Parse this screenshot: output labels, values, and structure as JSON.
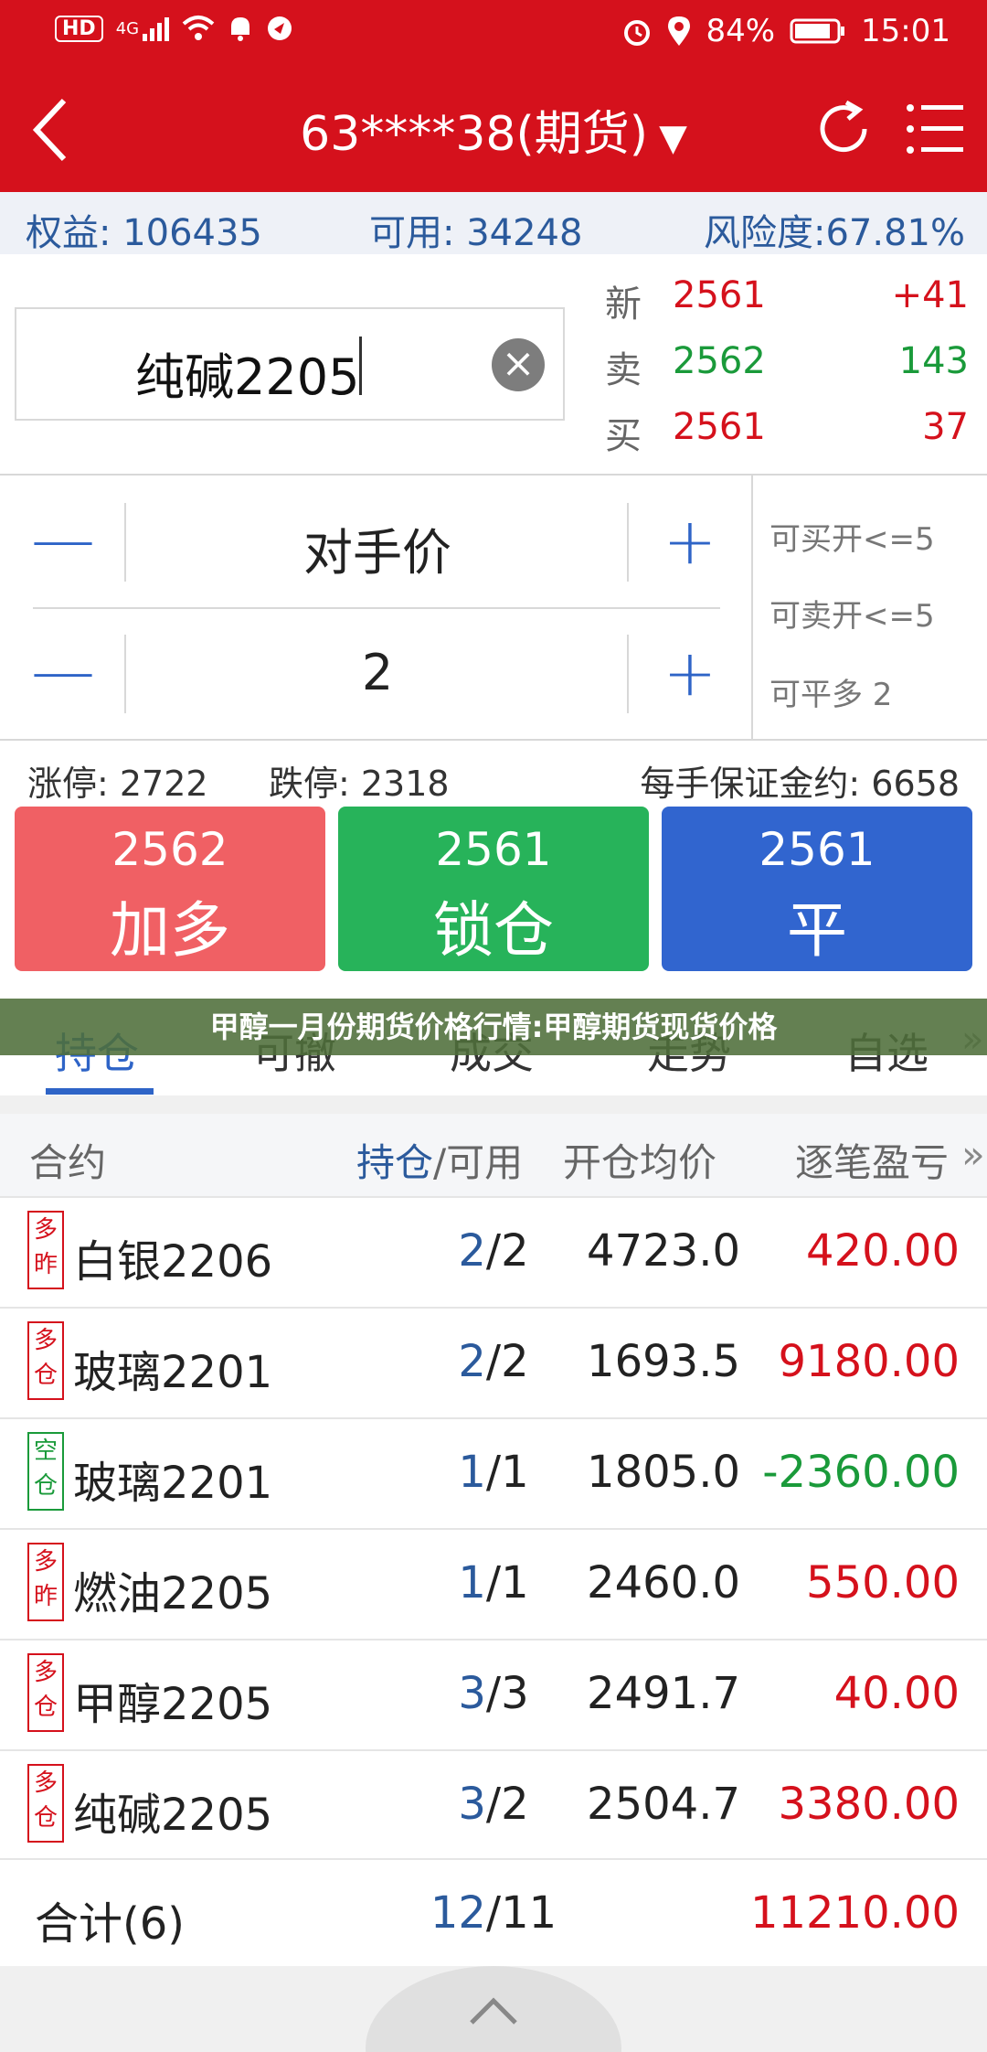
{
  "status": {
    "hd": "HD",
    "network": "4G",
    "battery": "84%",
    "time": "15:01"
  },
  "header": {
    "title": "63****38(期货)",
    "caret": "▼"
  },
  "equity": {
    "equity": "权益: 106435",
    "available": "可用: 34248",
    "risk": "风险度:67.81%"
  },
  "symbol": {
    "value": "纯碱2205",
    "clear": "×"
  },
  "quotes": [
    {
      "label": "新",
      "price": "2561",
      "extra": "+41"
    },
    {
      "label": "卖",
      "price": "2562",
      "extra": "143"
    },
    {
      "label": "买",
      "price": "2561",
      "extra": "37"
    }
  ],
  "order": {
    "price_mode": "对手价",
    "quantity": "2",
    "minus": "—",
    "plus": "+",
    "limits": [
      "可买开<=5",
      "可卖开<=5",
      "可平多 2"
    ]
  },
  "info": {
    "limit_up": "涨停: 2722",
    "limit_down": "跌停: 2318",
    "margin": "每手保证金约: 6658"
  },
  "trade_buttons": [
    {
      "price": "2562",
      "label": "加多",
      "color": "#f06064"
    },
    {
      "price": "2561",
      "label": "锁仓",
      "color": "#27b35a"
    },
    {
      "price": "2561",
      "label": "平",
      "color": "#3165cf"
    }
  ],
  "tabs": [
    "持仓",
    "可撤",
    "成交",
    "走势",
    "自选"
  ],
  "tab_more": "»",
  "banner": "甲醇一月份期货价格行情:甲醇期货现货价格",
  "table": {
    "headers": {
      "contract": "合约",
      "hold_blue": "持仓",
      "hold_rest": "/可用",
      "avg_price": "开仓均价",
      "pnl": "逐笔盈亏",
      "more": "»"
    },
    "rows": [
      {
        "badge": "多昨",
        "name": "白银2206",
        "hold": "2",
        "avail": "/2",
        "price": "4723.0",
        "pnl": "420.00",
        "side": "long"
      },
      {
        "badge": "多仓",
        "name": "玻璃2201",
        "hold": "2",
        "avail": "/2",
        "price": "1693.5",
        "pnl": "9180.00",
        "side": "long"
      },
      {
        "badge": "空仓",
        "name": "玻璃2201",
        "hold": "1",
        "avail": "/1",
        "price": "1805.0",
        "pnl": "-2360.00",
        "side": "short"
      },
      {
        "badge": "多昨",
        "name": "燃油2205",
        "hold": "1",
        "avail": "/1",
        "price": "2460.0",
        "pnl": "550.00",
        "side": "long"
      },
      {
        "badge": "多仓",
        "name": "甲醇2205",
        "hold": "3",
        "avail": "/3",
        "price": "2491.7",
        "pnl": "40.00",
        "side": "long"
      },
      {
        "badge": "多仓",
        "name": "纯碱2205",
        "hold": "3",
        "avail": "/2",
        "price": "2504.7",
        "pnl": "3380.00",
        "side": "long"
      }
    ],
    "total": {
      "label": "合计(6)",
      "hold": "12",
      "avail": "/11",
      "pnl": "11210.00"
    }
  }
}
